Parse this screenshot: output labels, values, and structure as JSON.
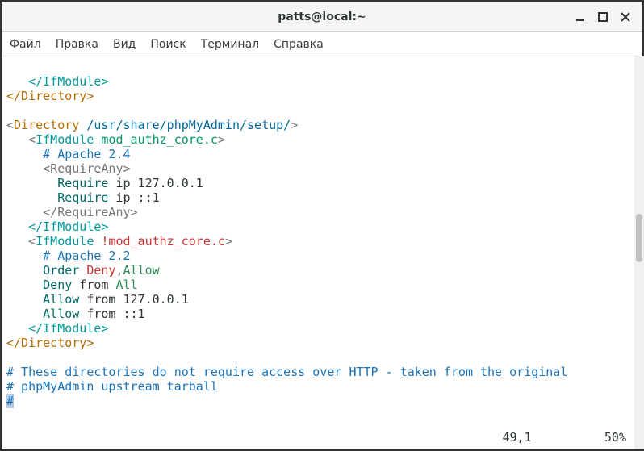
{
  "window": {
    "title": "patts@local:~"
  },
  "menu": {
    "file": "Файл",
    "edit": "Правка",
    "view": "Вид",
    "search": "Поиск",
    "terminal": "Терминал",
    "help": "Справка"
  },
  "code": {
    "l1_close_ifmod": "</IfModule>",
    "l2_close_dir": "</Directory>",
    "l3_dir_open_tag": "Directory",
    "l3_dir_path": "/usr/share/phpMyAdmin/setup/",
    "l4_ifmod_tag": "IfModule",
    "l4_mod": "mod_authz_core.c",
    "l5_cmt": "# Apache 2.4",
    "l6_reqany_open": "<RequireAny>",
    "l7_require": "Require",
    "l7_ip1": " ip 127.0.0.1",
    "l8_require": "Require",
    "l8_ip2": " ip ::1",
    "l9_reqany_close": "</RequireAny>",
    "l10_close_ifmod": "</IfModule>",
    "l11_ifmod_tag": "IfModule",
    "l11_neg": "!mod_authz_core.c",
    "l12_cmt": "# Apache 2.2",
    "l13_order": "Order",
    "l13_deny": "Deny",
    "l13_comma": ",",
    "l13_allow": "Allow",
    "l14_deny": "Deny",
    "l14_from": " from ",
    "l14_all": "All",
    "l15_allow": "Allow",
    "l15_rest": " from 127.0.0.1",
    "l16_allow": "Allow",
    "l16_rest": " from ::1",
    "l17_close_ifmod": "</IfModule>",
    "l18_close_dir": "</Directory>",
    "l19_cmt": "# These directories do not require access over HTTP - taken from the original",
    "l20_cmt": "# phpMyAdmin upstream tarball",
    "l21_cursor": "#"
  },
  "status": {
    "pos": "49,1",
    "pct": "50%"
  }
}
